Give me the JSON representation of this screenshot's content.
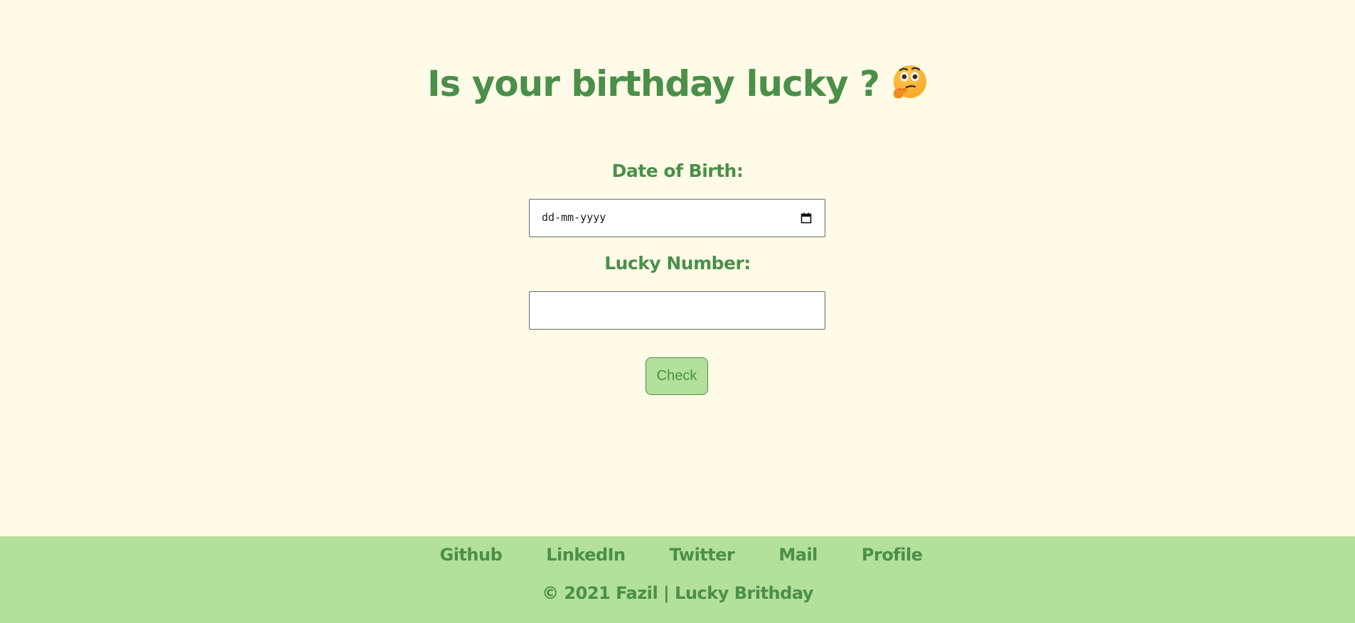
{
  "header": {
    "title": "Is your birthday lucky ?",
    "emoji_icon": "thinking-face-icon"
  },
  "form": {
    "dob_label": "Date of Birth:",
    "dob_placeholder": "dd-mm-yyyy",
    "dob_value": "",
    "lucky_label": "Lucky Number:",
    "lucky_value": "",
    "check_label": "Check"
  },
  "footer": {
    "links": [
      "Github",
      "LinkedIn",
      "Twitter",
      "Mail",
      "Profile"
    ],
    "copyright": "© 2021 Fazil | Lucky Brithday"
  },
  "colors": {
    "background": "#fffbe6",
    "accent": "#4a8f4a",
    "footer_bg": "#b3e09a",
    "button_bg": "#b3e09a"
  }
}
